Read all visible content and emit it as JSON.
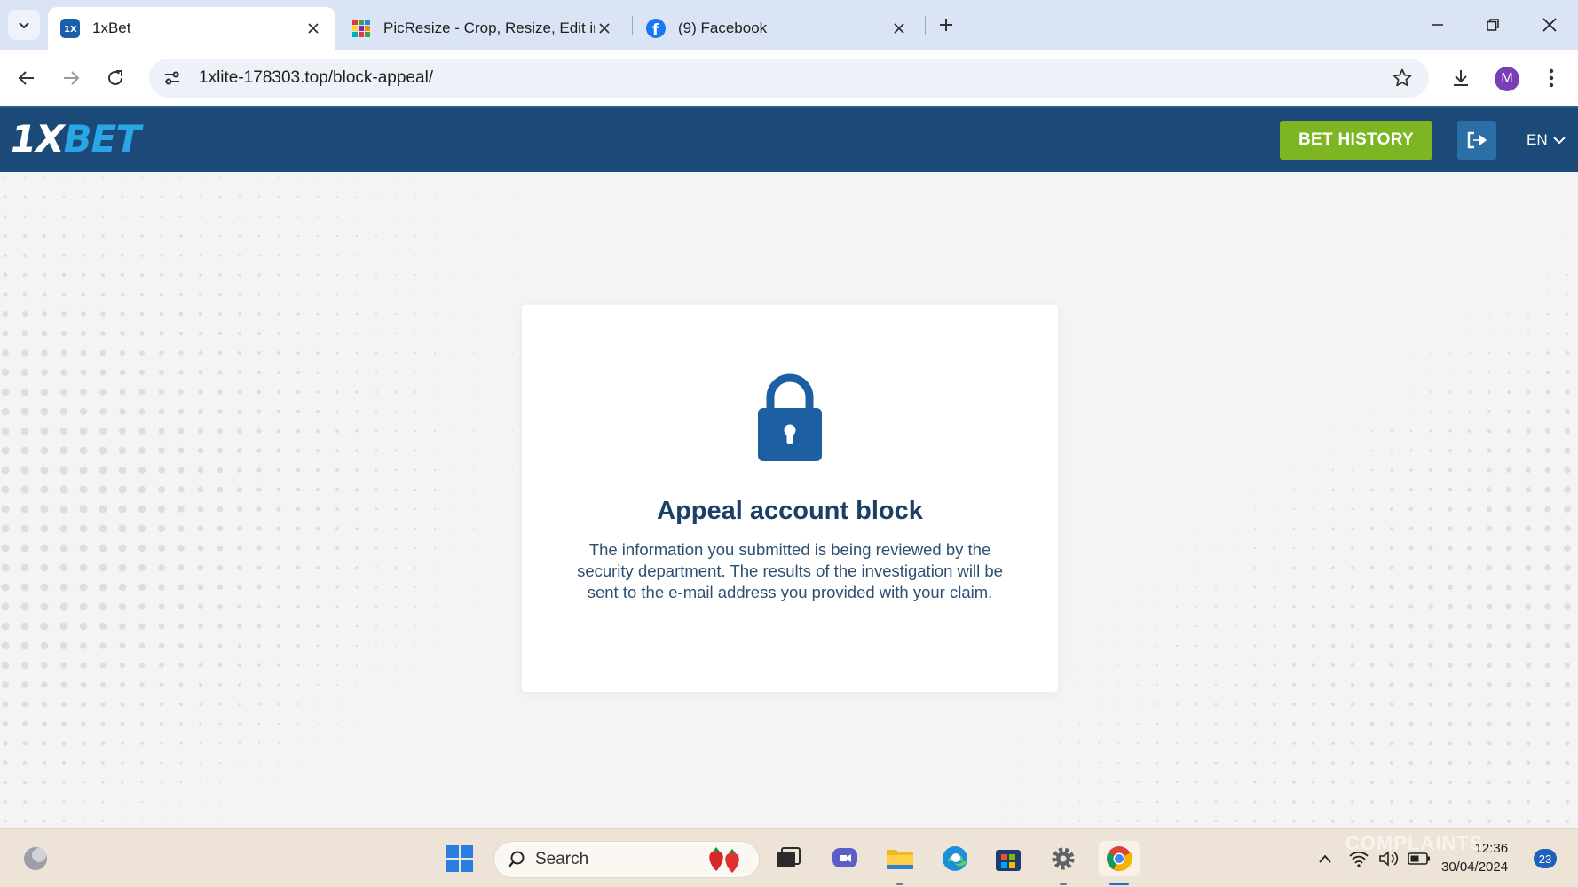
{
  "browser": {
    "tabs": [
      {
        "title": "1xBet",
        "active": true
      },
      {
        "title": "PicResize - Crop, Resize, Edit im",
        "active": false
      },
      {
        "title": "(9) Facebook",
        "active": false
      }
    ],
    "url": "1xlite-178303.top/block-appeal/",
    "profile_initial": "M"
  },
  "site": {
    "logo_primary": "1X",
    "logo_accent": "BET",
    "bet_history_label": "BET HISTORY",
    "language": "EN",
    "colors": {
      "header": "#1b4a78",
      "button_green": "#7db523",
      "accent": "#28a6e6"
    }
  },
  "appeal": {
    "title": "Appeal account block",
    "message": "The information you submitted is being reviewed by the security department. The results of the investigation will be sent to the e-mail address you provided with your claim."
  },
  "taskbar": {
    "search_label": "Search",
    "time": "12:36",
    "date": "30/04/2024",
    "notification_count": "23",
    "watermark": "COMPLAINTS"
  }
}
